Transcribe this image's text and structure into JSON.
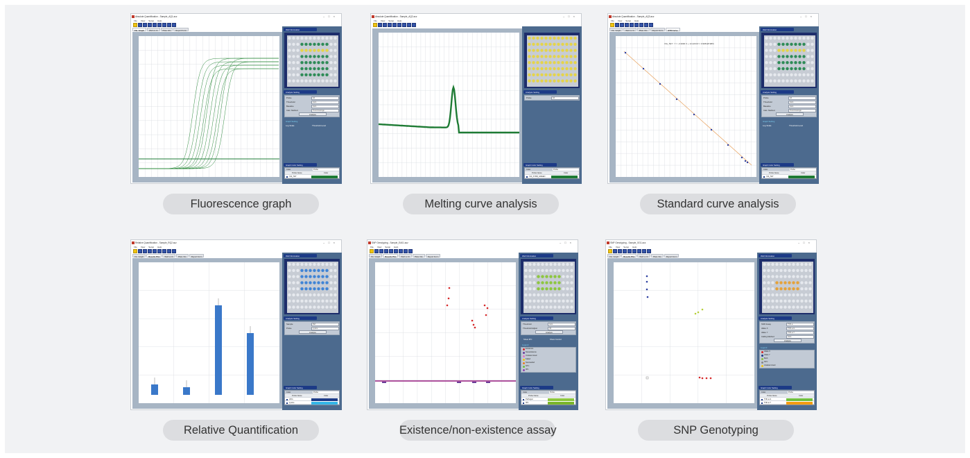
{
  "captions": {
    "fluorescence": "Fluorescence graph",
    "melting": "Melting curve analysis",
    "standard": "Standard curve analysis",
    "relative": "Relative Quantification",
    "existence": "Existence/non-existence assay",
    "snp": "SNP Genotyping"
  },
  "windows": {
    "fluorescence": {
      "title": "Absolute Quantification - Sample_AQ1.acz",
      "menu": [
        "File",
        "View",
        "Setup",
        "Help"
      ],
      "tabs": [
        "Flu. Graph",
        "Well vs Ct",
        "Plate Info",
        "Report Form"
      ],
      "active_tab": "Flu. Graph",
      "panels": {
        "well_info": "Well Information",
        "analysis": "Analysis Setting",
        "graph_setting": "Graph Setting",
        "color": "Graph Color Setting"
      },
      "settings": [
        [
          "Probe",
          "All"
        ],
        [
          "Threshold",
          "Auto"
        ],
        [
          "Baseline",
          "Auto"
        ],
        [
          "Calc. Method",
          "Trend Average"
        ]
      ],
      "analyze": "Analyze",
      "log_scale": "Log Scale",
      "threshold_level": "Threshold Level",
      "color_mode": [
        "Color",
        "Probe"
      ],
      "color_cols": [
        "Probe Name",
        "Color"
      ],
      "probes": [
        {
          "name": "VIA_TET",
          "color": "#1e7b34"
        }
      ]
    },
    "melting": {
      "title": "Absolute Quantification - Sample_AQ2.acz",
      "menu": [
        "File",
        "View",
        "Setup",
        "Help"
      ],
      "panels": {
        "analysis": "Analysis Setting",
        "color": "Graph Color Setting"
      },
      "settings": [
        [
          "Probe",
          "All"
        ]
      ],
      "color_mode": [
        "Color",
        "Probe"
      ],
      "color_cols": [
        "Probe Name",
        "Color"
      ],
      "probes": [
        {
          "name": "VIA_SYBR_GREEN",
          "color": "#1e7b34"
        }
      ]
    },
    "standard": {
      "title": "Absolute Quantification - Sample_AQ3.acz",
      "menu": [
        "File",
        "View",
        "Setup",
        "Help"
      ],
      "tabs": [
        "Flu. Graph",
        "Well vs Ct",
        "Plate Info",
        "Report Form",
        "STD Curve"
      ],
      "active_tab": "STD Curve",
      "equation": "VIA_TET : Y = -3.3000 X + 13.420    R² = 0.998 Eff:98%",
      "panels": {
        "well_info": "Well Information",
        "analysis": "Analysis Setting",
        "graph_setting": "Graph Setting",
        "color": "Graph Color Setting"
      },
      "settings": [
        [
          "Probe",
          "All"
        ],
        [
          "Threshold",
          "Auto"
        ],
        [
          "Baseline",
          "Auto"
        ],
        [
          "Calc. Method",
          "Trend Average"
        ]
      ],
      "analyze": "Analyze",
      "log_scale": "Log Scale",
      "threshold_level": "Threshold Level",
      "color_mode": [
        "Color",
        "Probe"
      ],
      "color_cols": [
        "Probe Name",
        "Color"
      ],
      "probes": [
        {
          "name": "VIA_TET",
          "color": "#1e7b34"
        }
      ]
    },
    "relative": {
      "title": "Relative Quantification - Sample_RQ2.acz",
      "menu": [
        "File",
        "View",
        "Setup",
        "Help"
      ],
      "tabs": [
        "Flu. Graph",
        "Results Plot",
        "Well vs Ct",
        "Plate Info",
        "Report Form"
      ],
      "active_tab": "Results Plot",
      "panels": {
        "well_info": "Well Information",
        "analysis": "Analysis Setting",
        "graph_setting": "Graph Setting",
        "color": "Graph Color Setting"
      },
      "settings": [
        [
          "Sample",
          "Ref."
        ],
        [
          "Probe",
          "Lysine"
        ]
      ],
      "analyze": "Analyze",
      "color_mode": [
        "Color",
        "Probe"
      ],
      "color_cols": [
        "Probe Name",
        "Color"
      ],
      "probes": [
        {
          "name": "HKG",
          "color": "#1c3a86"
        },
        {
          "name": "Lysine",
          "color": "#33b5e8"
        }
      ]
    },
    "existence": {
      "title": "SNP Genotyping - Sample_EA01.acz",
      "menu": [
        "File",
        "View",
        "Setup",
        "Help"
      ],
      "tabs": [
        "Flu. Graph",
        "Results Plot",
        "Well vs Ct",
        "Plate Info",
        "Report Form"
      ],
      "active_tab": "Results Plot",
      "panels": {
        "well_info": "Well Information",
        "analysis": "Analysis Setting",
        "color": "Graph Color Setting"
      },
      "settings": [
        [
          "Threshold",
          "Auto"
        ],
        [
          "Threshold Adjust",
          "(0)"
        ]
      ],
      "analyze": "Analyze",
      "options": [
        "Show IPC",
        "Show Control"
      ],
      "legend_title": "Legend",
      "legend": [
        {
          "label": "Existence",
          "color": "#d62728"
        },
        {
          "label": "Nonexistence",
          "color": "#6a3d9a"
        },
        {
          "label": "Undetermined",
          "color": "#e377c2"
        },
        {
          "label": "Failed",
          "color": "#f1c40f"
        },
        {
          "label": "Succeeded",
          "color": "#e67e22"
        },
        {
          "label": "NTC",
          "color": "#6fbf3f"
        },
        {
          "label": "IPC",
          "color": "#8e44ad"
        }
      ],
      "color_mode": [
        "Color",
        "Probe"
      ],
      "color_cols": [
        "Probe Name",
        "Color"
      ],
      "probes": [
        {
          "name": "Pathogen",
          "color": "#8dc63f"
        },
        {
          "name": "IPC",
          "color": "#7bb62a"
        }
      ]
    },
    "snp": {
      "title": "SNP Genotyping - Sample_SG1.acz",
      "menu": [
        "File",
        "View",
        "Setup",
        "Help"
      ],
      "tabs": [
        "Flu. Graph",
        "Results Plot",
        "Well vs Ct",
        "Plate Info",
        "Report Form"
      ],
      "active_tab": "Results Plot",
      "panels": {
        "well_info": "Well Information",
        "analysis": "Analysis Setting",
        "color": "Graph Color Setting"
      },
      "settings": [
        [
          "SNP Assay",
          "TNF-a"
        ],
        [
          "Allele X",
          "TNF-a-G"
        ],
        [
          "Allele Y",
          "TNF-a-T"
        ],
        [
          "Calling Method",
          "Auto"
        ]
      ],
      "analyze": "Analyze",
      "legend_title": "Legend",
      "legend": [
        {
          "label": "Allele X",
          "color": "#d62728"
        },
        {
          "label": "Allele Y",
          "color": "#1c3a86"
        },
        {
          "label": "Both",
          "color": "#8dc63f"
        },
        {
          "label": "NTC",
          "color": "#888888"
        },
        {
          "label": "Undetermined",
          "color": "#f1c40f"
        }
      ],
      "color_mode": [
        "Color",
        "Probe"
      ],
      "color_cols": [
        "Probe Name",
        "Color"
      ],
      "probes": [
        {
          "name": "TNF-a-G",
          "color": "#6fbf3f"
        },
        {
          "name": "TNF-a-T",
          "color": "#f39c12"
        }
      ]
    }
  },
  "colors": {
    "accent": "#1c3a86",
    "panel": "#4c6a8e",
    "graph_bg": "#a7b5c4",
    "curve": "#1e7b34",
    "caption_bg": "#dcdde0"
  }
}
